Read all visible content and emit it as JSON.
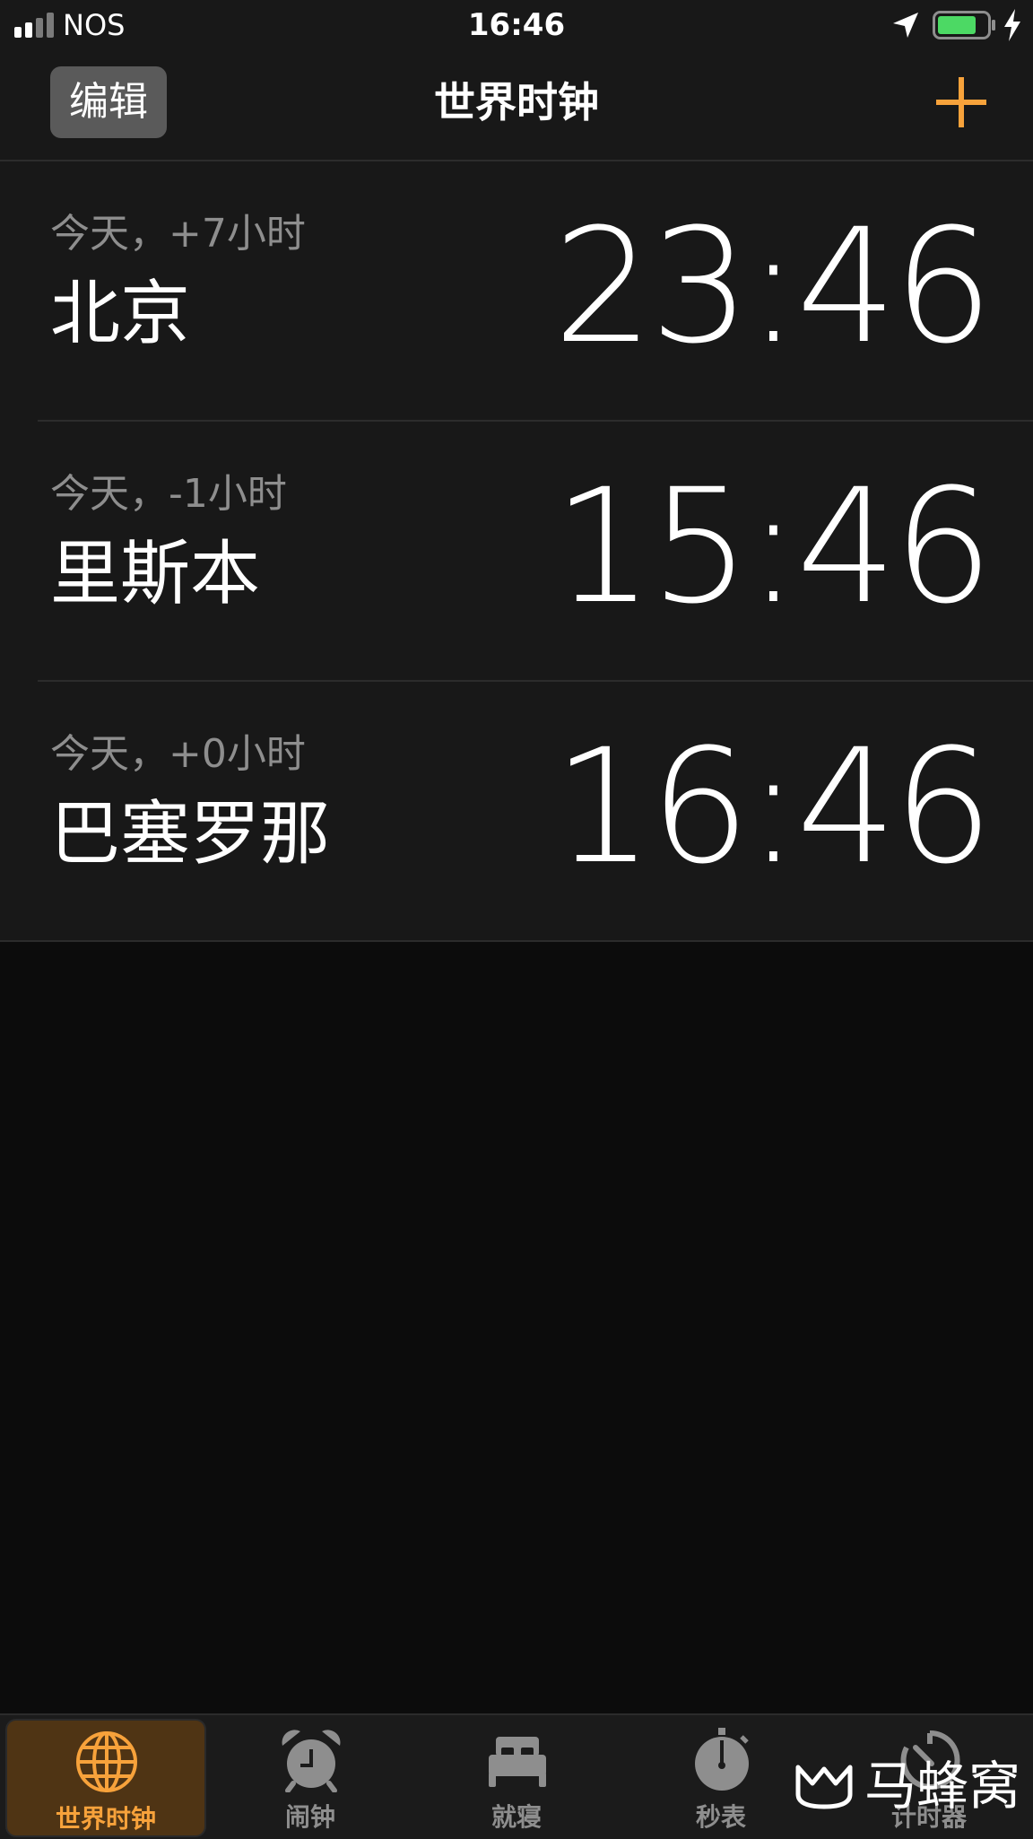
{
  "status_bar": {
    "carrier": "NOS",
    "time": "16:46",
    "signal_bars_active": 2,
    "signal_bars_total": 4,
    "battery_level": 0.8,
    "battery_color": "#4cd964",
    "charging": true,
    "location_icon": "location-arrow-icon"
  },
  "nav": {
    "edit_label": "编辑",
    "title": "世界时钟",
    "add_icon": "plus-icon",
    "accent_color": "#f7a23b"
  },
  "clocks": [
    {
      "offset": "今天，+7小时",
      "city": "北京",
      "time": "23:46"
    },
    {
      "offset": "今天，-1小时",
      "city": "里斯本",
      "time": "15:46"
    },
    {
      "offset": "今天，+0小时",
      "city": "巴塞罗那",
      "time": "16:46"
    }
  ],
  "tabs": [
    {
      "label": "世界时钟",
      "icon": "globe-icon",
      "active": true
    },
    {
      "label": "闹钟",
      "icon": "alarm-clock-icon",
      "active": false
    },
    {
      "label": "就寝",
      "icon": "bed-icon",
      "active": false
    },
    {
      "label": "秒表",
      "icon": "stopwatch-icon",
      "active": false
    },
    {
      "label": "计时器",
      "icon": "timer-icon",
      "active": false
    }
  ],
  "watermark": {
    "text": "马蜂窝"
  }
}
